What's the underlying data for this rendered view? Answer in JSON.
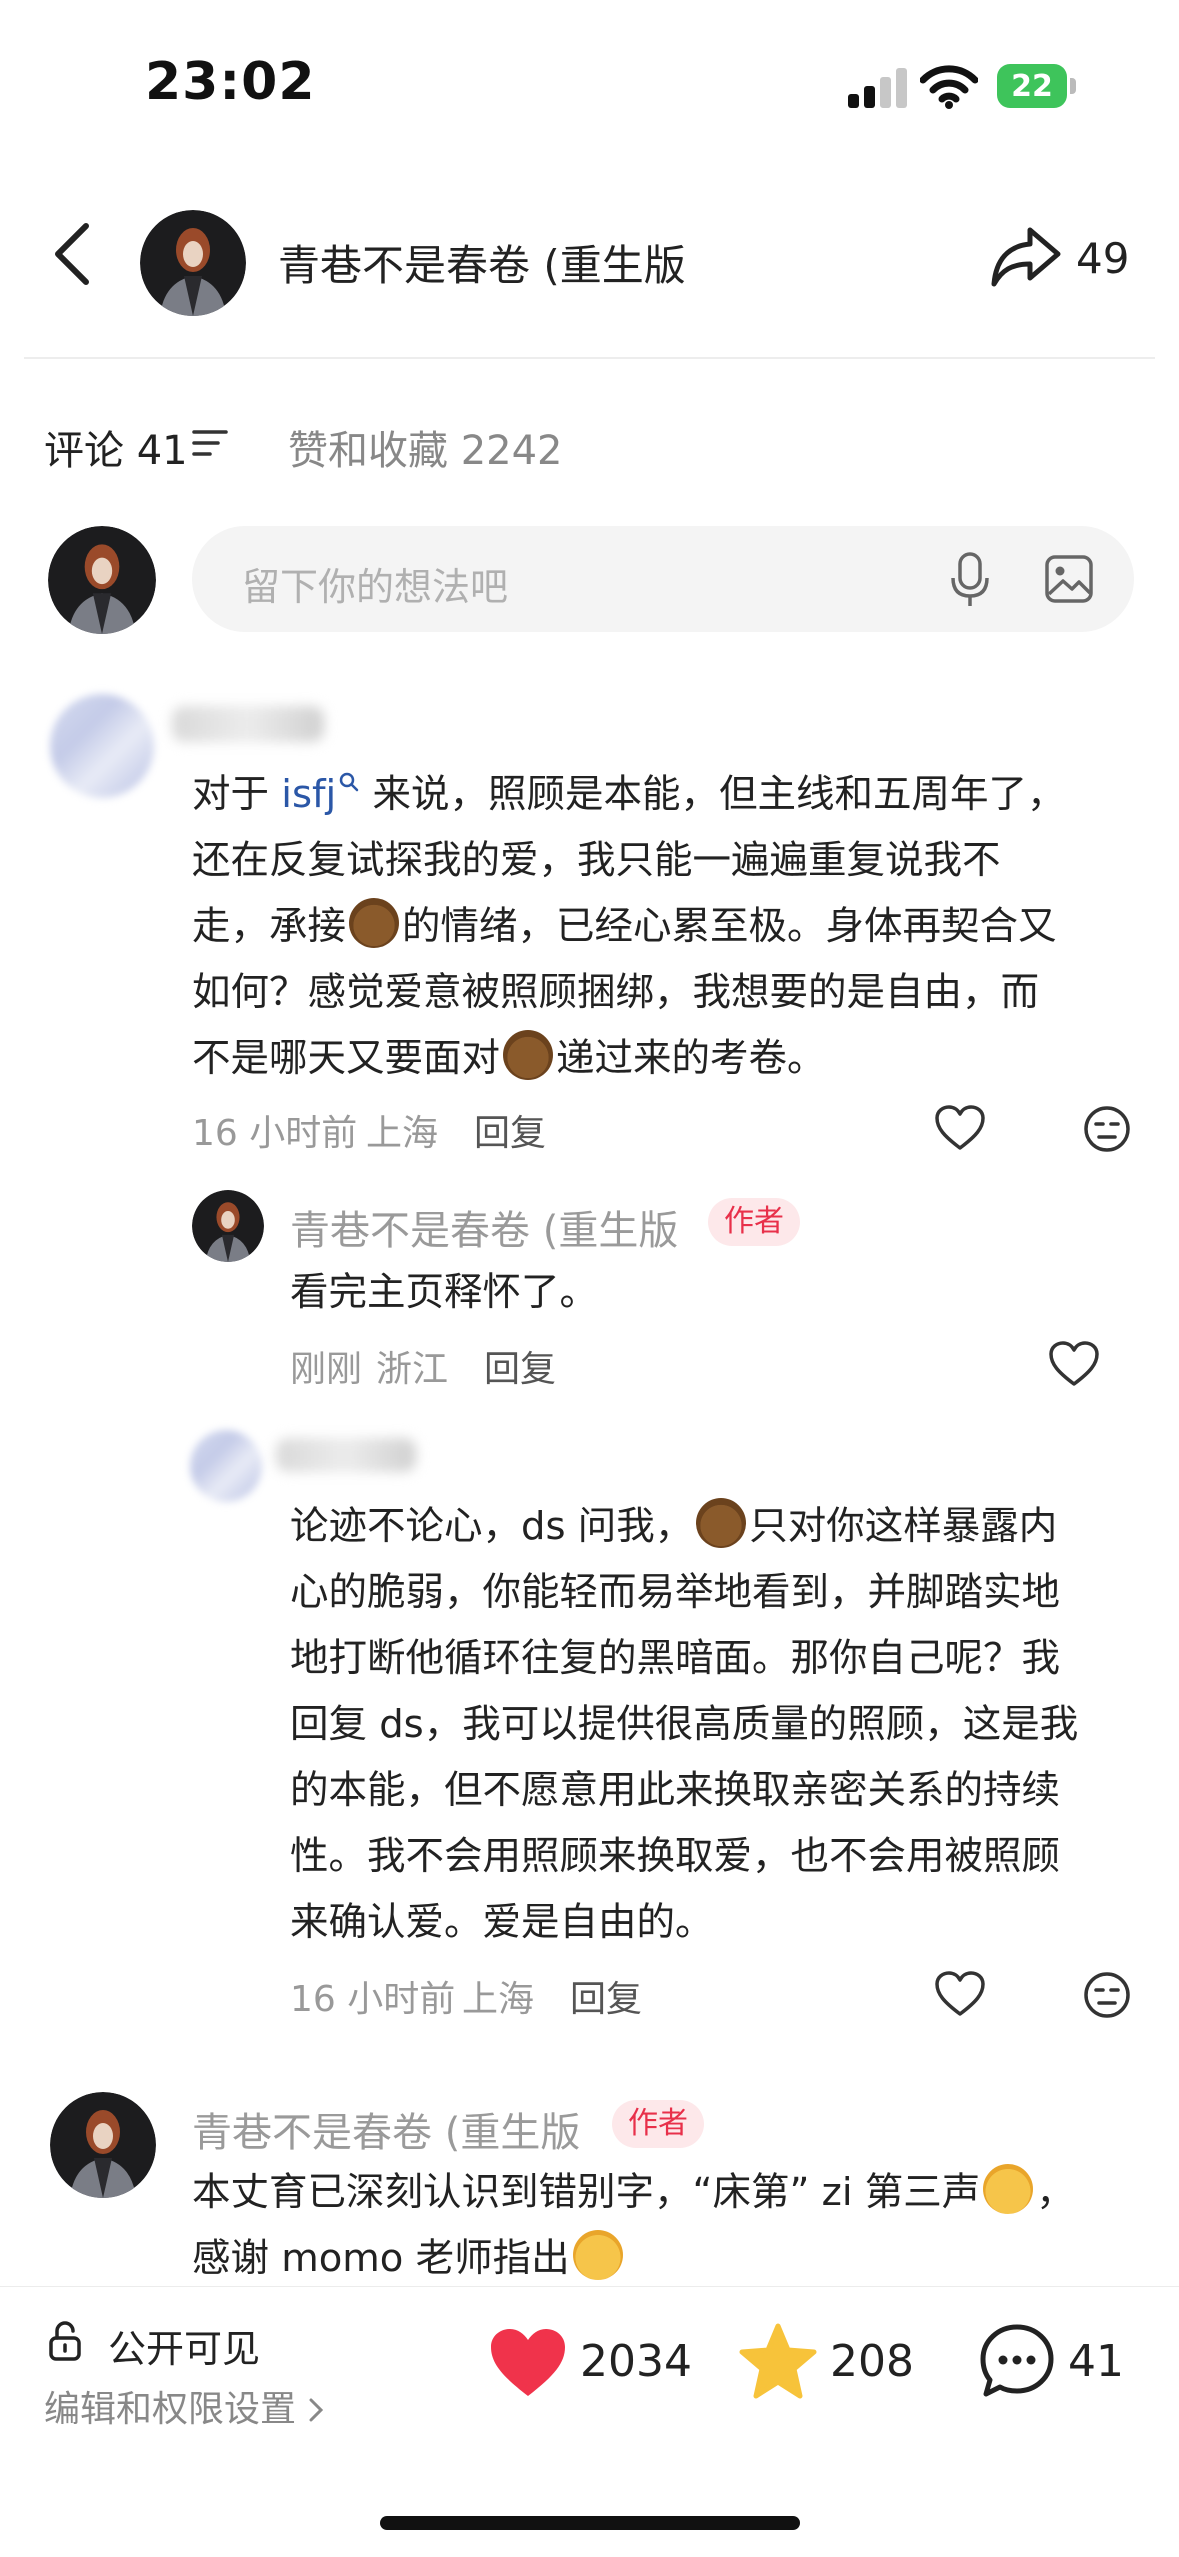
{
  "status": {
    "time": "23:02",
    "battery": "22"
  },
  "header": {
    "title": "青巷不是春卷 (重生版",
    "share_count": "49"
  },
  "tabs": {
    "comments": "评论 41",
    "likes_favs": "赞和收藏 2242"
  },
  "input": {
    "placeholder": "留下你的想法吧"
  },
  "comments": [
    {
      "text_before_link": "对于 ",
      "link": "isfj",
      "text_1": " 来说，照顾是本能，但主线和五周年了，",
      "text_2": "还在反复试探我的爱，我只能一遍遍重复说我不",
      "text_3a": "走，承接",
      "text_3b": "的情绪，已经心累至极。身体再契合又",
      "text_4": "如何？感觉爱意被照顾捆绑，我想要的是自由，而",
      "text_5a": "不是哪天又要面对",
      "text_5b": "递过来的考卷。",
      "time": "16 小时前",
      "location": "上海",
      "reply_label": "回复"
    }
  ],
  "reply1": {
    "name": "青巷不是春卷 (重生版",
    "badge": "作者",
    "text": "看完主页释怀了。",
    "time": "刚刚",
    "location": "浙江",
    "reply_label": "回复"
  },
  "reply2": {
    "line1a": "论迹不论心，ds 问我，",
    "line1b": "只对你这样暴露内",
    "line2": "心的脆弱，你能轻而易举地看到，并脚踏实地",
    "line3": "地打断他循环往复的黑暗面。那你自己呢？我",
    "line4": "回复 ds，我可以提供很高质量的照顾，这是我",
    "line5": "的本能，但不愿意用此来换取亲密关系的持续",
    "line6": "性。我不会用照顾来换取爱，也不会用被照顾",
    "line7": "来确认爱。爱是自由的。",
    "time": "16 小时前",
    "location": "上海",
    "reply_label": "回复"
  },
  "comment3": {
    "name": "青巷不是春卷 (重生版",
    "badge": "作者",
    "line1a": "本丈育已深刻认识到错别字，“床第” zi 第三声",
    "line1b": "，",
    "line2a": "感谢 momo 老师指出"
  },
  "bottom": {
    "visibility": "公开可见",
    "permission_link": "编辑和权限设置",
    "likes": "2034",
    "stars": "208",
    "comments": "41"
  },
  "colors": {
    "like_red": "#f0334b",
    "star_yellow": "#f7c33a",
    "link_blue": "#2b57a7",
    "author_red": "#e8304a"
  }
}
